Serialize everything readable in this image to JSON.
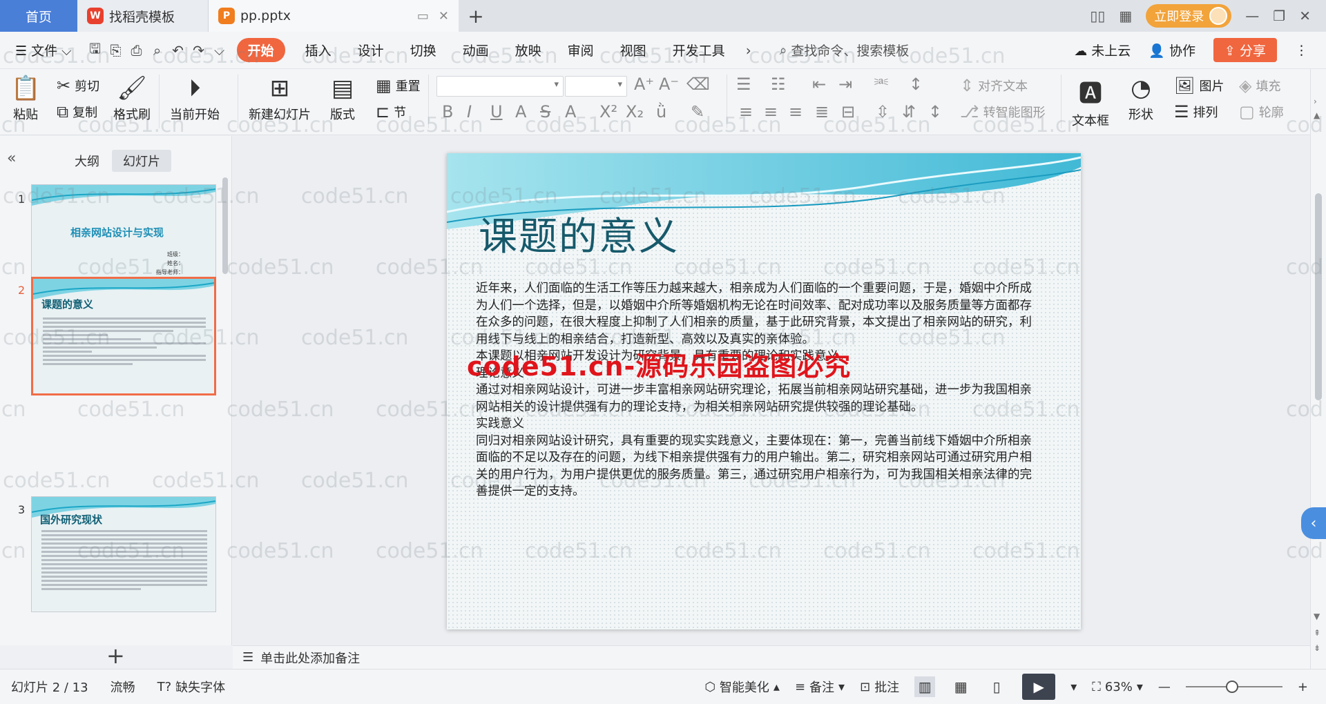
{
  "tabs": {
    "home": "首页",
    "docer": "找稻壳模板",
    "file": "pp.pptx",
    "login": "立即登录"
  },
  "menu": {
    "file": "文件",
    "items": [
      "开始",
      "插入",
      "设计",
      "切换",
      "动画",
      "放映",
      "审阅",
      "视图",
      "开发工具"
    ],
    "search": "查找命令、搜索模板",
    "cloud": "未上云",
    "collab": "协作",
    "share": "分享"
  },
  "ribbon": {
    "paste": "粘贴",
    "cut": "剪切",
    "copy": "复制",
    "format_painter": "格式刷",
    "from_current": "当前开始",
    "new_slide": "新建幻灯片",
    "layout": "版式",
    "reset": "重置",
    "section": "节",
    "align_text": "对齐文本",
    "smart_shape": "转智能图形",
    "textbox": "文本框",
    "shape": "形状",
    "picture": "图片",
    "arrange": "排列",
    "fill": "填充",
    "outline": "轮廓"
  },
  "panel": {
    "outline_tab": "大纲",
    "slides_tab": "幻灯片",
    "thumbs": [
      {
        "num": "1",
        "title": "相亲网站设计与实现",
        "meta": [
          "班级：",
          "姓名：",
          "指导老师："
        ]
      },
      {
        "num": "2",
        "title": "课题的意义"
      },
      {
        "num": "3",
        "title": "国外研究现状"
      }
    ]
  },
  "slide": {
    "title": "课题的意义",
    "paragraphs": [
      "近年来，人们面临的生活工作等压力越来越大，相亲成为人们面临的一个重要问题，于是，婚姻中介所成为人们一个选择，但是，以婚姻中介所等婚姻机构无论在时间效率、配对成功率以及服务质量等方面都存在众多的问题，在很大程度上抑制了人们相亲的质量，基于此研究背景，本文提出了相亲网站的研究，利用线下与线上的相亲结合，打造新型、高效以及真实的亲体验。",
      "本课题以相亲网站开发设计为研究背景，具有重要的理论和实践意义。",
      "理论意义",
      "通过对相亲网站设计，可进一步丰富相亲网站研究理论，拓展当前相亲网站研究基础，进一步为我国相亲网站相关的设计提供强有力的理论支持，为相关相亲网站研究提供较强的理论基础。",
      "实践意义",
      "同归对相亲网站设计研究，具有重要的现实实践意义，主要体现在：第一，完善当前线下婚姻中介所相亲面临的不足以及存在的问题，为线下相亲提供强有力的用户输出。第二，研究相亲网站可通过研究用户相关的用户行为，为用户提供更优的服务质量。第三，通过研究用户相亲行为，可为我国相关相亲法律的完善提供一定的支持。"
    ],
    "overlay": "code51.cn-源码乐园盗图必究"
  },
  "notes_placeholder": "单击此处添加备注",
  "status": {
    "slide_counter": "幻灯片 2 / 13",
    "theme": "流畅",
    "missing_font": "缺失字体",
    "beautify": "智能美化",
    "notes": "备注",
    "comments": "批注",
    "zoom": "63%"
  },
  "watermark_text": "code51.cn",
  "watermark_short": "cn",
  "watermark_cod": "cod"
}
